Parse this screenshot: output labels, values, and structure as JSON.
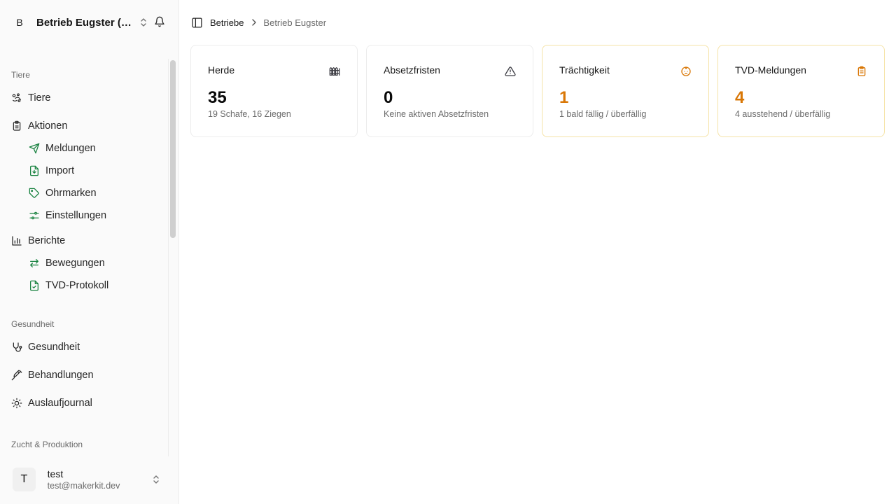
{
  "org": {
    "avatar_letter": "B",
    "name": "Betrieb Eugster (H..."
  },
  "sidebar": {
    "sections": [
      {
        "label": "Tiere"
      },
      {
        "label": "Gesundheit"
      },
      {
        "label": "Zucht & Produktion"
      }
    ],
    "items": [
      {
        "label": "Tiere",
        "icon": "animals-icon"
      },
      {
        "label": "Aktionen",
        "icon": "clipboard-icon"
      },
      {
        "label": "Meldungen",
        "icon": "send-icon"
      },
      {
        "label": "Import",
        "icon": "file-import-icon"
      },
      {
        "label": "Ohrmarken",
        "icon": "tag-icon"
      },
      {
        "label": "Einstellungen",
        "icon": "settings-sliders-icon"
      },
      {
        "label": "Berichte",
        "icon": "bar-chart-icon"
      },
      {
        "label": "Bewegungen",
        "icon": "arrows-exchange-icon"
      },
      {
        "label": "TVD-Protokoll",
        "icon": "file-check-icon"
      },
      {
        "label": "Gesundheit",
        "icon": "stethoscope-icon"
      },
      {
        "label": "Behandlungen",
        "icon": "syringe-icon"
      },
      {
        "label": "Auslaufjournal",
        "icon": "sun-icon"
      }
    ]
  },
  "user": {
    "avatar_letter": "T",
    "name": "test",
    "email": "test@makerkit.dev"
  },
  "breadcrumb": {
    "parent": "Betriebe",
    "current": "Betrieb Eugster"
  },
  "cards": [
    {
      "title": "Herde",
      "value": "35",
      "subtitle": "19 Schafe, 16 Ziegen",
      "icon": "fence-icon"
    },
    {
      "title": "Absetzfristen",
      "value": "0",
      "subtitle": "Keine aktiven Absetzfristen",
      "icon": "warning-triangle-icon"
    },
    {
      "title": "Trächtigkeit",
      "value": "1",
      "subtitle": "1 bald fällig / überfällig",
      "icon": "baby-icon"
    },
    {
      "title": "TVD-Meldungen",
      "value": "4",
      "subtitle": "4 ausstehend / überfällig",
      "icon": "clipboard-list-icon"
    }
  ],
  "colors": {
    "accent_green": "#15803d",
    "warning_orange": "#d97706",
    "muted_text": "#6b6b6b"
  }
}
